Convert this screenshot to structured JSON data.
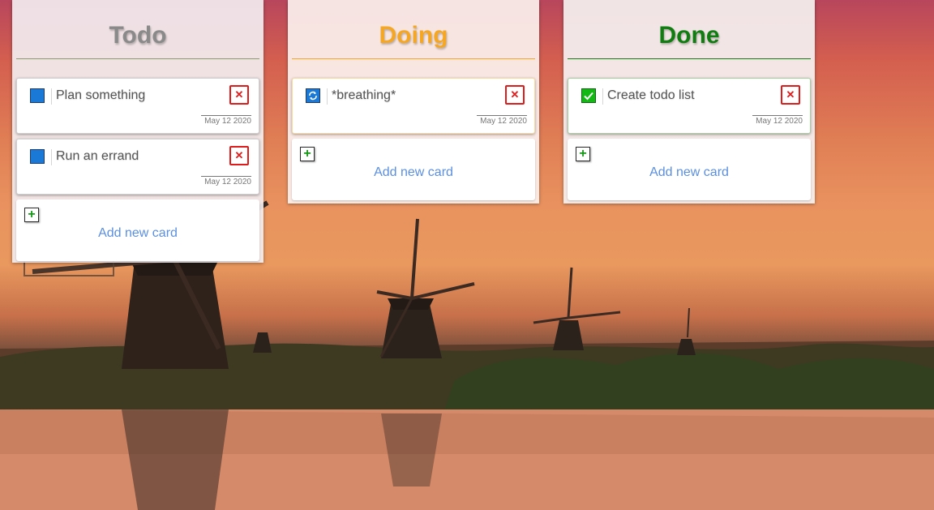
{
  "columns": {
    "todo": {
      "title": "Todo",
      "cards": [
        {
          "title": "Plan something",
          "date": "May 12 2020",
          "status": "todo"
        },
        {
          "title": "Run an errand",
          "date": "May 12 2020",
          "status": "todo"
        }
      ],
      "add_label": "Add new card"
    },
    "doing": {
      "title": "Doing",
      "cards": [
        {
          "title": "*breathing*",
          "date": "May 12 2020",
          "status": "doing"
        }
      ],
      "add_label": "Add new card"
    },
    "done": {
      "title": "Done",
      "cards": [
        {
          "title": "Create todo list",
          "date": "May 12 2020",
          "status": "done"
        }
      ],
      "add_label": "Add new card"
    }
  },
  "icons": {
    "delete": "close-icon",
    "add": "plus-icon",
    "todo_status": "square-icon",
    "doing_status": "refresh-icon",
    "done_status": "checkmark-icon"
  },
  "colors": {
    "todo": "#8a8a8a",
    "doing": "#f5a623",
    "done": "#0f7d0f",
    "delete": "#e01b1b",
    "link": "#5b8fe0"
  }
}
